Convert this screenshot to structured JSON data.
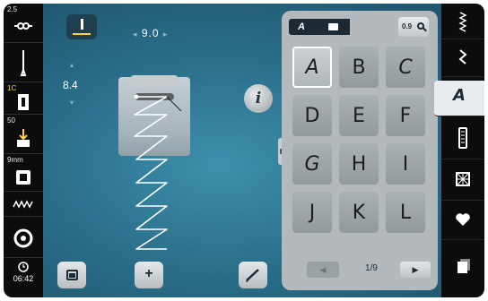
{
  "left_status": {
    "stitch_length_tag": "2.5",
    "presser_foot_tag": "1C",
    "foot_pressure_tag": "50",
    "stitch_width_tag": "9mm",
    "clock": "06:42"
  },
  "stitch_params": {
    "length_value": "9.0",
    "width_value": "8.4"
  },
  "info_label": "i",
  "alphabet_panel": {
    "crumb_category": "A",
    "zoom_label": "0.9",
    "letters": [
      "A",
      "B",
      "C",
      "D",
      "E",
      "F",
      "G",
      "H",
      "I",
      "J",
      "K",
      "L"
    ],
    "selected": "A",
    "page_indicator": "1/9",
    "prev_label": "◀",
    "next_label": "▶"
  },
  "right_categories": [
    {
      "name": "decorative",
      "glyph": "⁞"
    },
    {
      "name": "practical",
      "glyph": "⟆"
    },
    {
      "name": "alphabets",
      "glyph": "A",
      "active": true
    },
    {
      "name": "buttonholes",
      "glyph": "▮"
    },
    {
      "name": "quilting",
      "glyph": "▩"
    },
    {
      "name": "favorites",
      "glyph": "♥"
    },
    {
      "name": "personal",
      "glyph": "▮"
    }
  ],
  "bottom_buttons": {
    "add_label": "+"
  },
  "colors": {
    "accent_yellow": "#ffd24a",
    "panel_dark": "#1c2a36",
    "background_teal": "#2b6f8b"
  }
}
